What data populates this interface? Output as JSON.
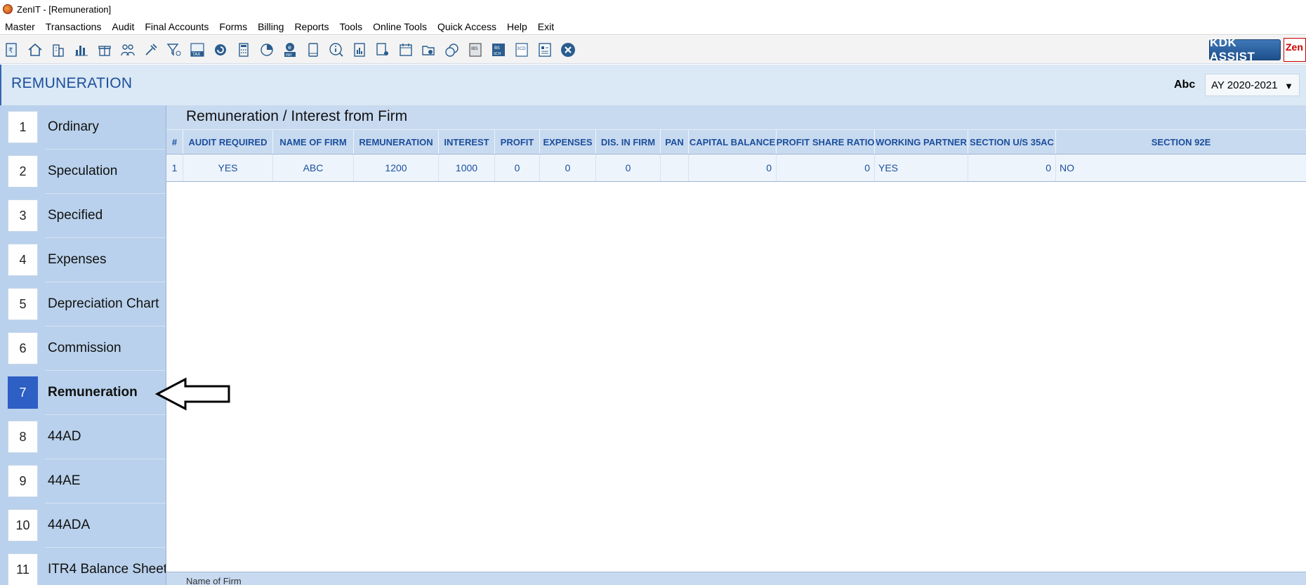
{
  "window": {
    "title": "ZenIT - [Remuneration]"
  },
  "menu": [
    {
      "label": "Master"
    },
    {
      "label": "Transactions"
    },
    {
      "label": "Audit"
    },
    {
      "label": "Final Accounts"
    },
    {
      "label": "Forms"
    },
    {
      "label": "Billing"
    },
    {
      "label": "Reports"
    },
    {
      "label": "Tools"
    },
    {
      "label": "Online Tools"
    },
    {
      "label": "Quick Access"
    },
    {
      "label": "Help"
    },
    {
      "label": "Exit"
    }
  ],
  "toolbar": {
    "icons": [
      "rupee-doc-icon",
      "home-icon",
      "building-icon",
      "bar-chart-icon",
      "gift-icon",
      "people-icon",
      "tools-icon",
      "filter-icon",
      "tax-icon",
      "refresh-icon",
      "calculator-icon",
      "pie-icon",
      "e-pay-icon",
      "book-icon",
      "info-icon",
      "report-icon",
      "document-user-icon",
      "calendar-icon",
      "folder-add-icon",
      "coins-icon",
      "ibs-icon",
      "bs-sch-icon",
      "3cd-icon",
      "form-icon",
      "close-circle-icon"
    ],
    "tax_text": "TAX",
    "pay_text": "PAY",
    "ibs_text": "IBS",
    "bs_text": "BS",
    "sch_text": "SCH",
    "cd_text": "3CD",
    "kdk_label": "KDK ASSIST",
    "zen_label": "Zen I"
  },
  "header": {
    "title": "REMUNERATION",
    "abc_label": "Abc",
    "assessment_year": "AY 2020-2021",
    "dropdown_arrow": "▼"
  },
  "sidebar": {
    "items": [
      {
        "num": "1",
        "label": "Ordinary"
      },
      {
        "num": "2",
        "label": "Speculation"
      },
      {
        "num": "3",
        "label": "Specified"
      },
      {
        "num": "4",
        "label": "Expenses"
      },
      {
        "num": "5",
        "label": "Depreciation Chart"
      },
      {
        "num": "6",
        "label": "Commission"
      },
      {
        "num": "7",
        "label": "Remuneration"
      },
      {
        "num": "8",
        "label": "44AD"
      },
      {
        "num": "9",
        "label": "44AE"
      },
      {
        "num": "10",
        "label": "44ADA"
      },
      {
        "num": "11",
        "label": "ITR4 Balance Sheet"
      }
    ],
    "active_index": 6
  },
  "main": {
    "section_title": "Remuneration / Interest from Firm",
    "columns": [
      "#",
      "AUDIT REQUIRED",
      "NAME OF FIRM",
      "REMUNERATION",
      "INTEREST",
      "PROFIT",
      "EXPENSES",
      "DIS. IN FIRM",
      "PAN",
      "CAPITAL BALANCE",
      "PROFIT SHARE RATIO",
      "WORKING PARTNER",
      "SECTION U/S 35AC",
      "SECTION 92E"
    ],
    "rows": [
      [
        "1",
        "YES",
        "ABC",
        "1200",
        "1000",
        "0",
        "0",
        "0",
        "",
        "0",
        "0",
        "YES",
        "0",
        "NO"
      ]
    ],
    "footer_label": "Name of Firm"
  }
}
